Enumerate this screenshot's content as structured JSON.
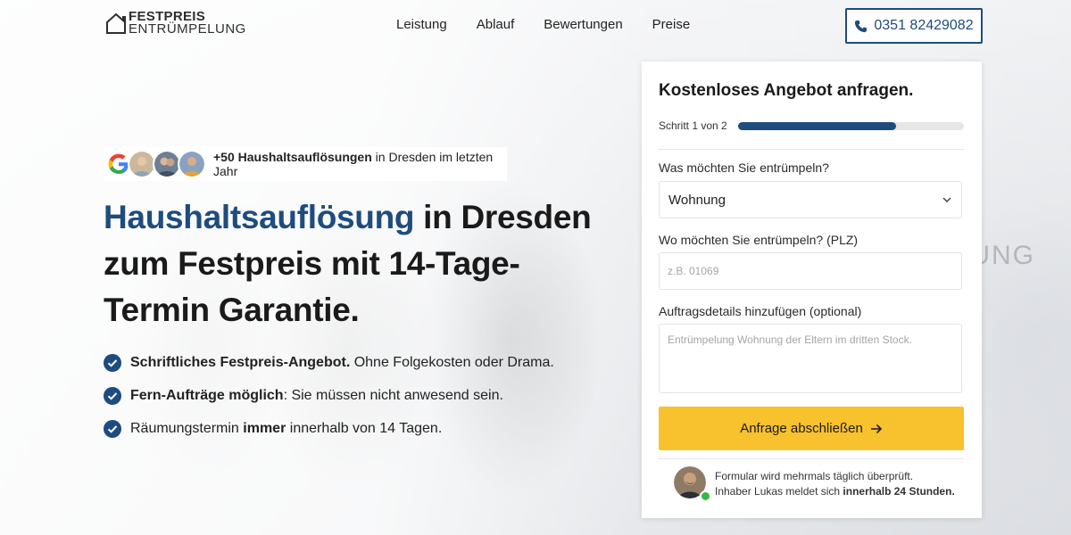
{
  "header": {
    "logo": {
      "line1": "FESTPREIS",
      "line2": "ENTRÜMPELUNG",
      "icon": "house-outline-icon"
    },
    "nav": [
      "Leistung",
      "Ablauf",
      "Bewertungen",
      "Preise"
    ],
    "phone": {
      "icon": "phone-icon",
      "number": "0351 82429082"
    }
  },
  "hero": {
    "social_proof": {
      "icons": [
        "google-icon",
        "customer-avatar-1",
        "customer-avatar-2",
        "customer-avatar-3"
      ],
      "bold": "+50 Haushaltsauflösungen",
      "rest": " in Dresden im letzten Jahr"
    },
    "headline": {
      "accent": "Haushaltsauflösung",
      "rest": " in Dresden zum Festpreis mit 14-Tage-Termin Garantie."
    },
    "bullets": [
      {
        "bold": "Schriftliches Festpreis-Angebot.",
        "rest": " Ohne Folgekosten oder Drama."
      },
      {
        "bold": "Fern-Aufträge möglich",
        "rest": ": Sie müssen nicht anwesend sein."
      },
      {
        "pre": "Räumungstermin ",
        "bold": "immer",
        "rest": " innerhalb von 14 Tagen."
      }
    ],
    "background_lettering": "LUNG"
  },
  "form": {
    "title": "Kostenloses Angebot anfragen.",
    "step_label": "Schritt 1 von 2",
    "progress": 0.7,
    "what_label": "Was möchten Sie entrümpeln?",
    "what_value": "Wohnung",
    "plz_label": "Wo möchten Sie entrümpeln? (PLZ)",
    "plz_placeholder": "z.B. 01069",
    "details_label": "Auftragsdetails hinzufügen (optional)",
    "details_placeholder": "Entrümpelung Wohnung der Eltern im dritten Stock.",
    "submit_label": "Anfrage abschließen",
    "note_line1": "Formular wird mehrmals täglich überprüft.",
    "note_line2_pre": "Inhaber Lukas meldet sich ",
    "note_line2_bold": "innerhalb 24 Stunden."
  },
  "colors": {
    "accent": "#1e4c7e",
    "button": "#f8c12e",
    "online": "#3bb54a"
  }
}
